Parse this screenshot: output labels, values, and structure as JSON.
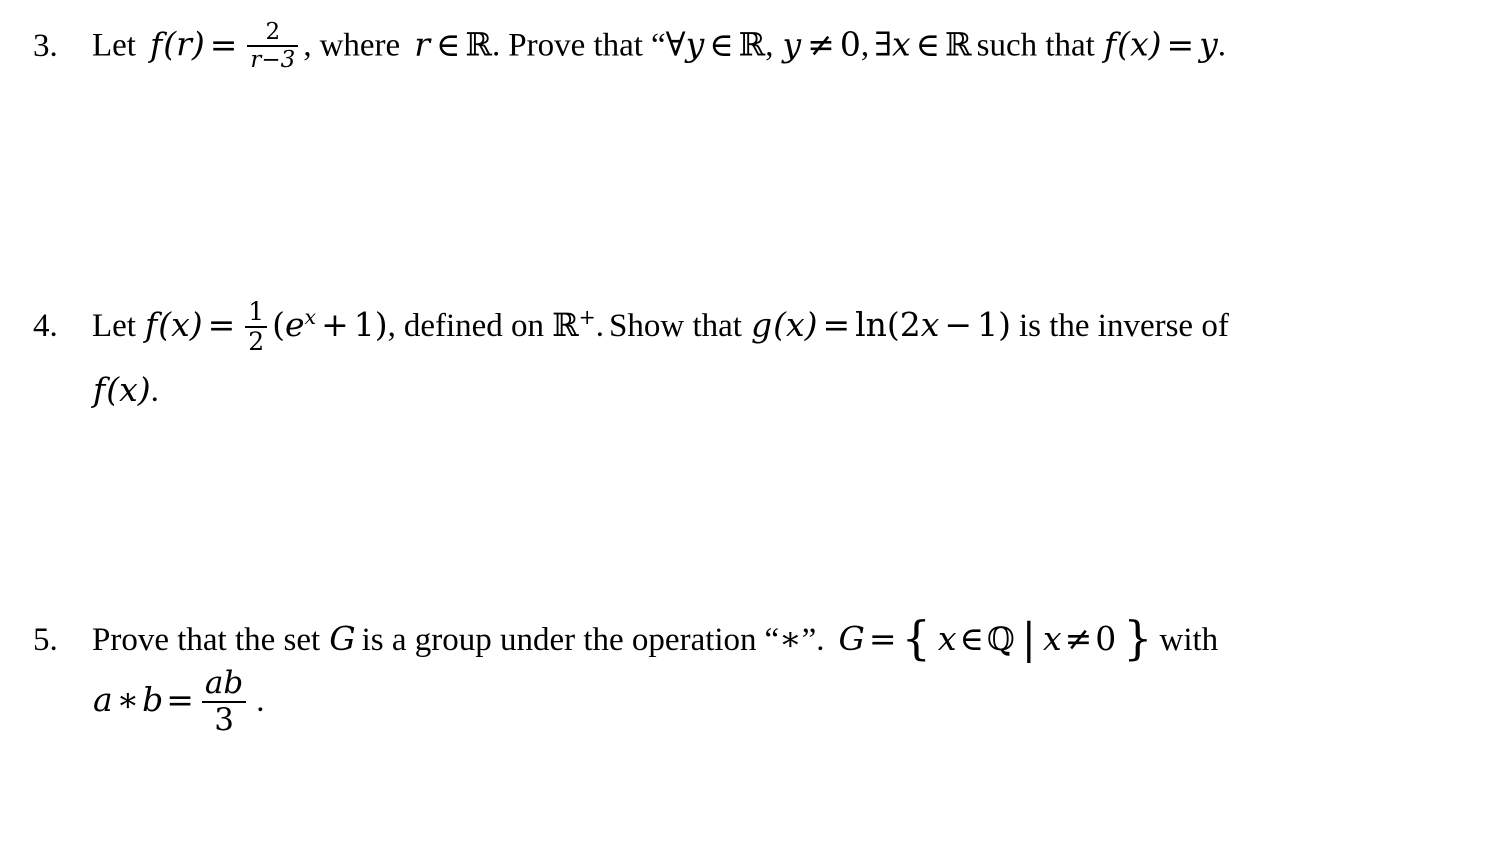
{
  "document": {
    "kind": "math-problem-set",
    "background_color": "#ffffff",
    "text_color": "#000000"
  },
  "problems": [
    {
      "number": "3.",
      "plain_text": "Let f(r) = 2/(r-3), where r ∈ ℝ. Prove that “∀y ∈ ℝ, y ≠ 0, ∃x ∈ ℝ such that f(x) = y.",
      "tokens": {
        "let": "Let",
        "f": "f",
        "paren_open": "(",
        "r": "r",
        "paren_close": ")",
        "equals": "=",
        "frac_num": "2",
        "frac_den_r": "r",
        "frac_den_minus": "−",
        "frac_den_3": "3",
        "comma": ",",
        "where": "where",
        "r_var": "r",
        "in": "∈",
        "reals": "ℝ",
        "period": ".",
        "prove_that": "Prove that",
        "quote_open": "“",
        "forall": "∀",
        "y": "y",
        "in2": "∈",
        "reals2": "ℝ",
        "comma2": ",",
        "y2": "y",
        "neq": "≠",
        "zero": "0",
        "comma3": ",",
        "exists": "∃",
        "x": "x",
        "in3": "∈",
        "reals3": "ℝ",
        "such_that": "such that",
        "f2": "f",
        "paren_open2": "(",
        "x2": "x",
        "paren_close2": ")",
        "equals2": "=",
        "y3": "y",
        "final_period": "."
      }
    },
    {
      "number": "4.",
      "plain_text": "Let f(x) = 1/2 (e^x + 1), defined on ℝ⁺. Show that g(x) = ln(2x − 1) is the inverse of f(x).",
      "tokens": {
        "let": "Let",
        "f": "f",
        "paren_open": "(",
        "x": "x",
        "paren_close": ")",
        "equals": "=",
        "frac_num": "1",
        "frac_den": "2",
        "group_open": "(",
        "e": "e",
        "exp_x": "x",
        "plus": "+",
        "one": "1",
        "group_close": ")",
        "comma": ",",
        "defined_on": "defined on",
        "reals": "ℝ",
        "plus_sup": "+",
        "period": ".",
        "show_that": "Show that",
        "g": "g",
        "paren_open2": "(",
        "x2": "x",
        "paren_close2": ")",
        "equals2": "=",
        "ln": "ln",
        "paren_open3": "(",
        "two": "2",
        "x3": "x",
        "minus": "−",
        "one2": "1",
        "paren_close3": ")",
        "is_the_inverse_of": "is the inverse of",
        "f2": "f",
        "paren_open4": "(",
        "x4": "x",
        "paren_close4": ")",
        "final_period": "."
      }
    },
    {
      "number": "5.",
      "plain_text": "Prove that the set G is a group under the operation “∗”. G = { x ∈ ℚ | x ≠ 0 } with a ∗ b = ab/3 .",
      "tokens": {
        "prove_that_the_set": "Prove that the set",
        "G": "G",
        "is_a_group_under_the_operation": "is a group under the operation",
        "quote_open": "“",
        "star": "∗",
        "quote_close": "”",
        "period": ".",
        "G2": "G",
        "equals": "=",
        "brace_open": "{",
        "x": "x",
        "in": "∈",
        "rationals": "ℚ",
        "bar": "|",
        "x2": "x",
        "neq": "≠",
        "zero": "0",
        "brace_close": "}",
        "with": "with",
        "a": "a",
        "star2": "∗",
        "b": "b",
        "equals2": "=",
        "frac_num": "ab",
        "frac_den": "3",
        "final_period": "."
      }
    }
  ]
}
